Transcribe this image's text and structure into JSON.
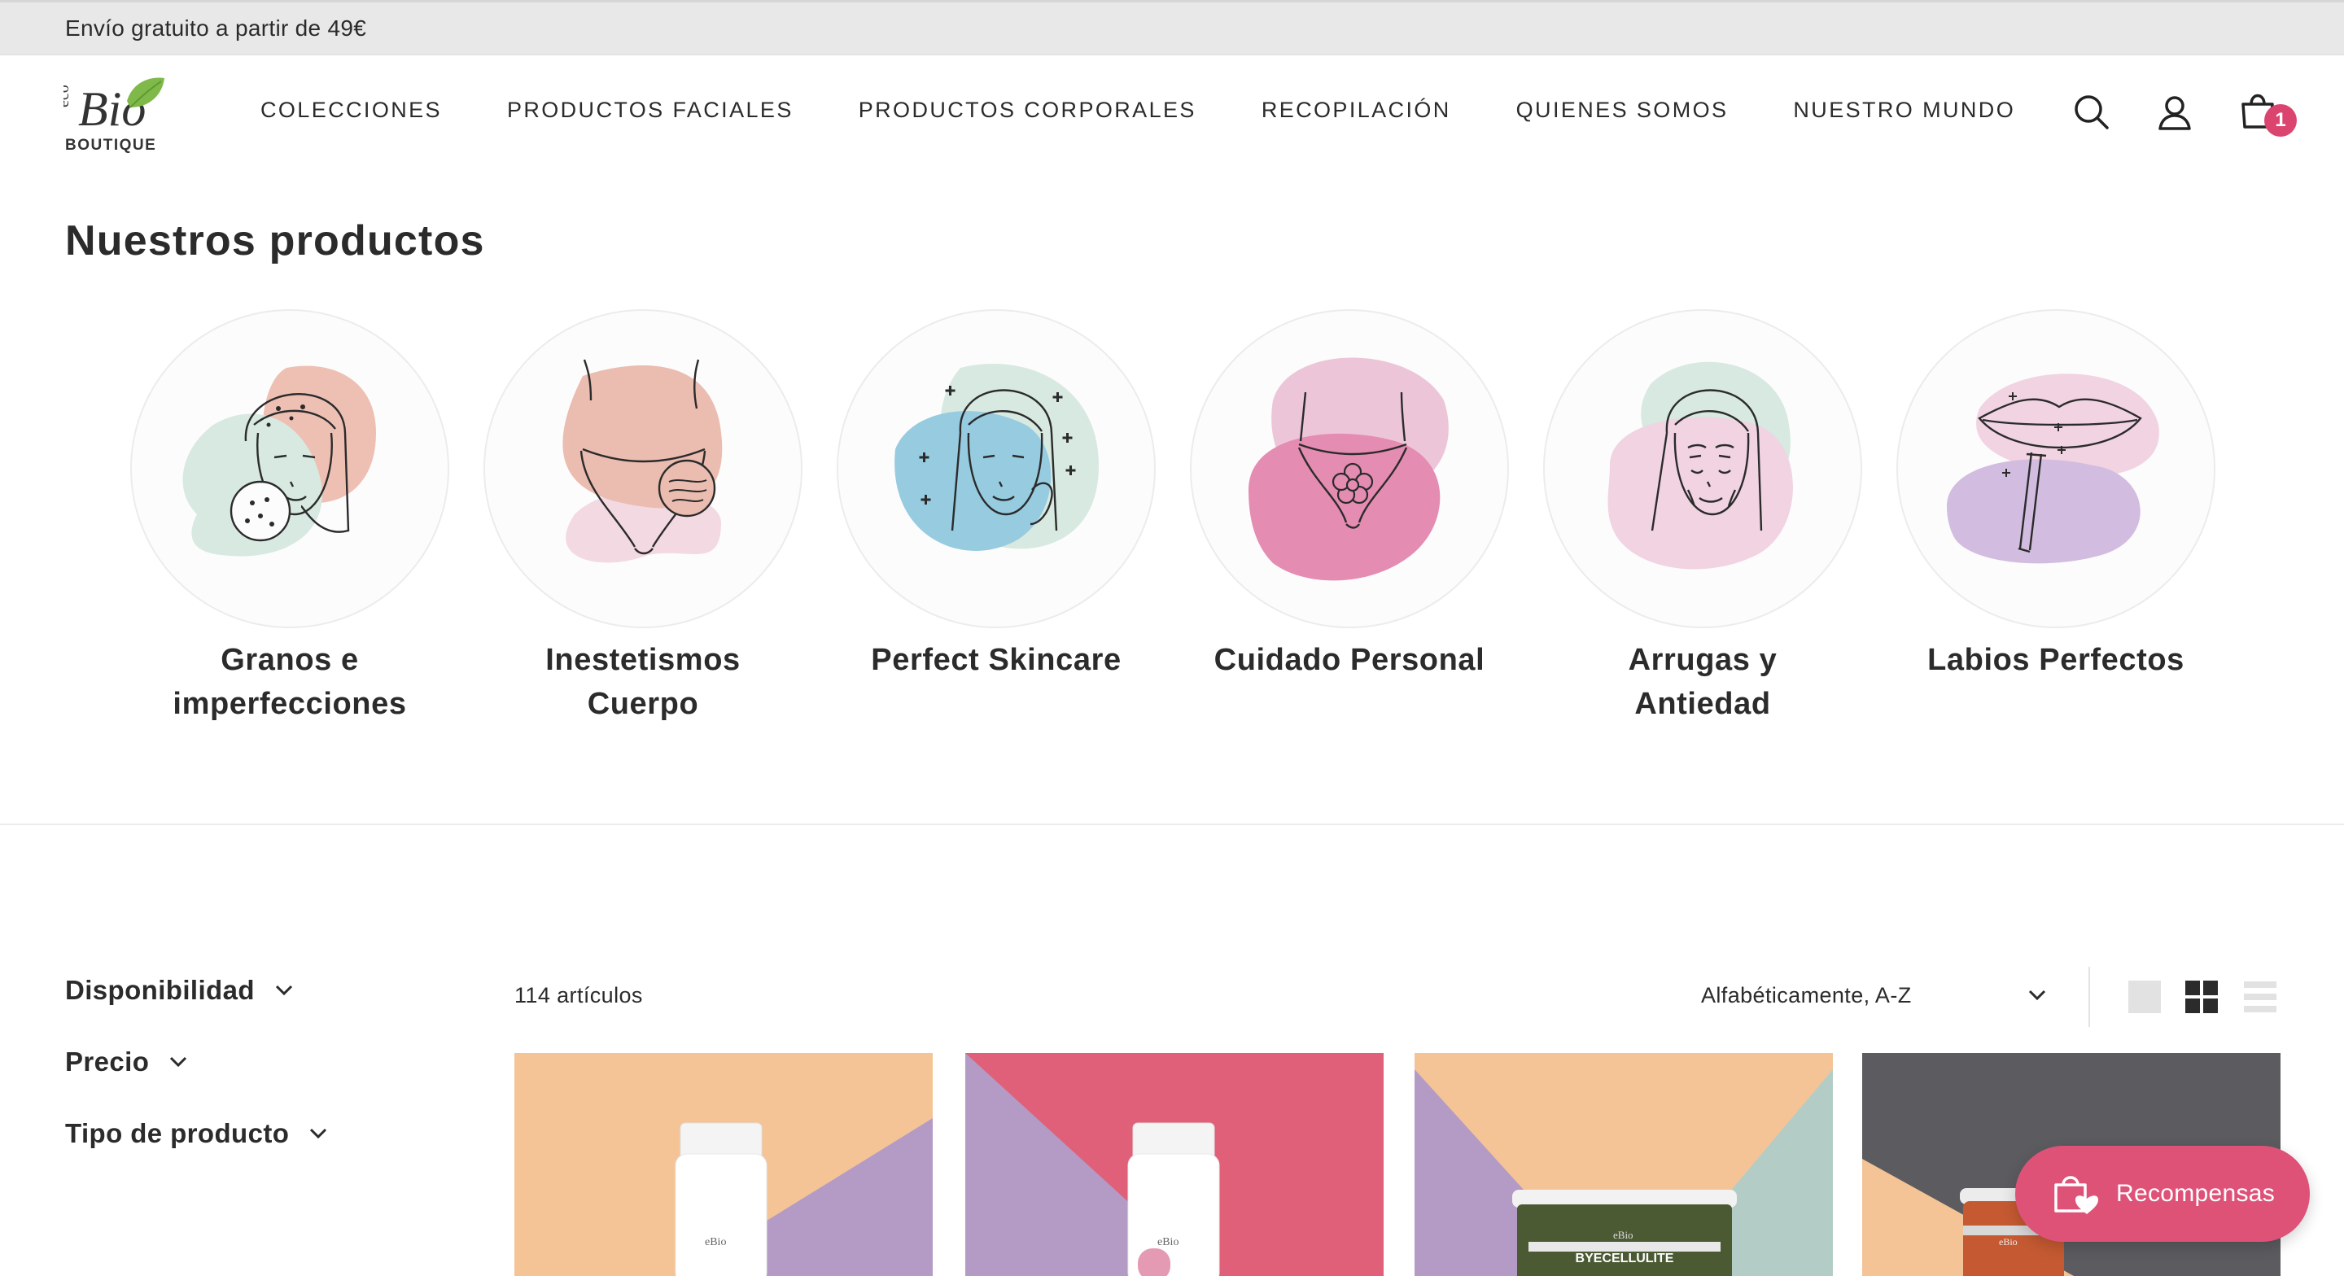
{
  "announcement": {
    "text": "Envío gratuito a partir de 49€"
  },
  "header": {
    "logo_alt": "ecoBio BOUTIQUE",
    "logo_text": "BOUTIQUE",
    "nav": [
      {
        "label": "COLECCIONES"
      },
      {
        "label": "PRODUCTOS FACIALES"
      },
      {
        "label": "PRODUCTOS CORPORALES"
      },
      {
        "label": "RECOPILACIÓN"
      },
      {
        "label": "QUIENES SOMOS"
      },
      {
        "label": "NUESTRO MUNDO"
      }
    ],
    "icons": [
      "search-icon",
      "account-icon",
      "cart-icon"
    ],
    "cart_count": "1"
  },
  "section": {
    "title": "Nuestros productos"
  },
  "categories": [
    {
      "label_line1": "Granos e",
      "label_line2": "imperfecciones",
      "icon": "acne-face-illustration"
    },
    {
      "label_line1": "Inestetismos",
      "label_line2": "Cuerpo",
      "icon": "body-illustration"
    },
    {
      "label_line1": "Perfect Skincare",
      "label_line2": "",
      "icon": "skincare-face-illustration"
    },
    {
      "label_line1": "Cuidado Personal",
      "label_line2": "",
      "icon": "intimate-care-illustration"
    },
    {
      "label_line1": "Arrugas y",
      "label_line2": "Antiedad",
      "icon": "aging-face-illustration"
    },
    {
      "label_line1": "Labios Perfectos",
      "label_line2": "",
      "icon": "lips-illustration"
    }
  ],
  "filters": [
    {
      "label": "Disponibilidad"
    },
    {
      "label": "Precio"
    },
    {
      "label": "Tipo de producto"
    }
  ],
  "toolbar": {
    "count": "114 artículos",
    "sort": "Alfabéticamente, A-Z",
    "views": [
      "large-grid",
      "small-grid",
      "list"
    ]
  },
  "products": [
    {
      "background": [
        "#f4c497",
        "#b39bc6"
      ],
      "item": "pump-bottle"
    },
    {
      "background": [
        "#e06079",
        "#b39bc6"
      ],
      "item": "pump-bottle"
    },
    {
      "background": [
        "#f4c497",
        "#b39bc6",
        "#b3cdc6"
      ],
      "item": "jar",
      "jar_text": "BYECELLULITE"
    },
    {
      "background": [
        "#5c5c60",
        "#f4c497"
      ],
      "item": "jar"
    }
  ],
  "rewards": {
    "label": "Recompensas"
  },
  "colors": {
    "accent": "#dc4470",
    "rewards": "#de5278",
    "peach": "#f4c497",
    "lavender": "#b39bc6",
    "mint": "#b3cdc6",
    "pink": "#e06079"
  }
}
